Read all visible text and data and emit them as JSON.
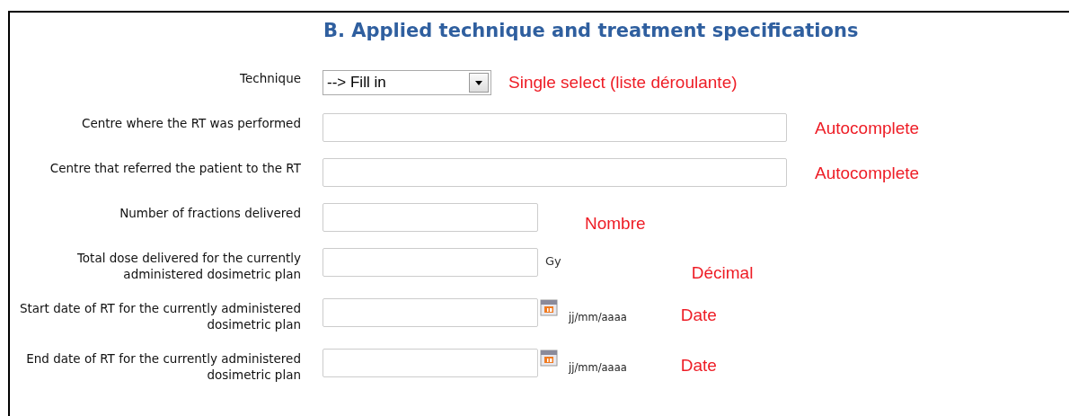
{
  "title": "B. Applied technique and treatment specifications",
  "fields": [
    {
      "kind": "select",
      "label": "Technique",
      "value": "--> Fill in",
      "note": "Single select (liste déroulante)"
    },
    {
      "kind": "wide",
      "label": "Centre where the RT was performed",
      "note": "Autocomplete"
    },
    {
      "kind": "wide",
      "label": "Centre that referred the patient to the RT",
      "note": "Autocomplete"
    },
    {
      "kind": "number",
      "label": "Number of fractions delivered",
      "note": "Nombre"
    },
    {
      "kind": "unit",
      "label": "Total dose delivered for the currently administered dosimetric plan",
      "unit": "Gy",
      "note": "Décimal"
    },
    {
      "kind": "date",
      "label": "Start date of RT for the currently administered dosimetric plan",
      "format": "jj/mm/aaaa",
      "note": "Date"
    },
    {
      "kind": "date",
      "label": "End date of RT for the currently administered dosimetric plan",
      "format": "jj/mm/aaaa",
      "note": "Date"
    }
  ]
}
